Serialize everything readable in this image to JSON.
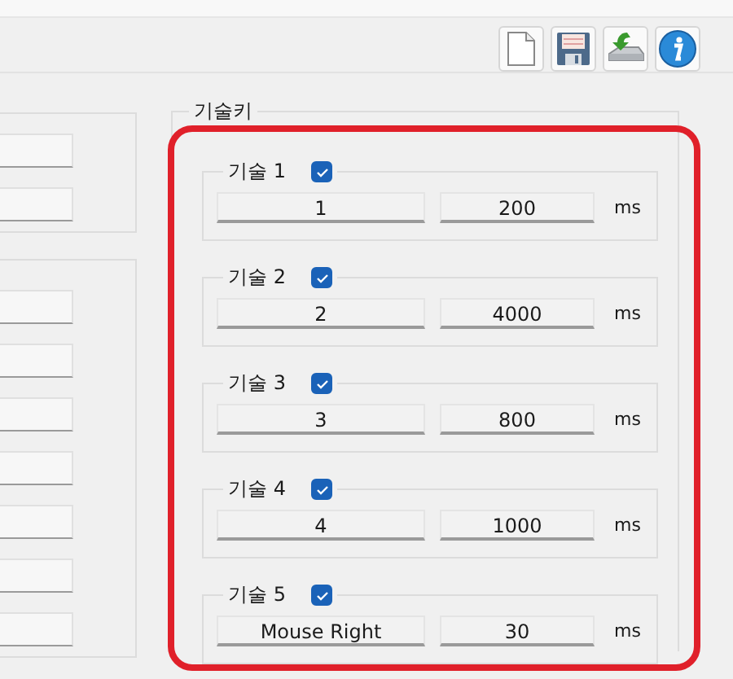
{
  "toolbar": [
    {
      "kind": "new"
    },
    {
      "kind": "save"
    },
    {
      "kind": "install"
    },
    {
      "kind": "info"
    }
  ],
  "skill_keys": {
    "title": "기술키",
    "skills": [
      {
        "label": "기술 1",
        "checked": true,
        "key": "1",
        "delay": "200",
        "unit": "ms"
      },
      {
        "label": "기술 2",
        "checked": true,
        "key": "2",
        "delay": "4000",
        "unit": "ms"
      },
      {
        "label": "기술 3",
        "checked": true,
        "key": "3",
        "delay": "800",
        "unit": "ms"
      },
      {
        "label": "기술 4",
        "checked": true,
        "key": "4",
        "delay": "1000",
        "unit": "ms"
      },
      {
        "label": "기술 5",
        "checked": true,
        "key": "Mouse Right",
        "delay": "30",
        "unit": "ms"
      }
    ]
  }
}
